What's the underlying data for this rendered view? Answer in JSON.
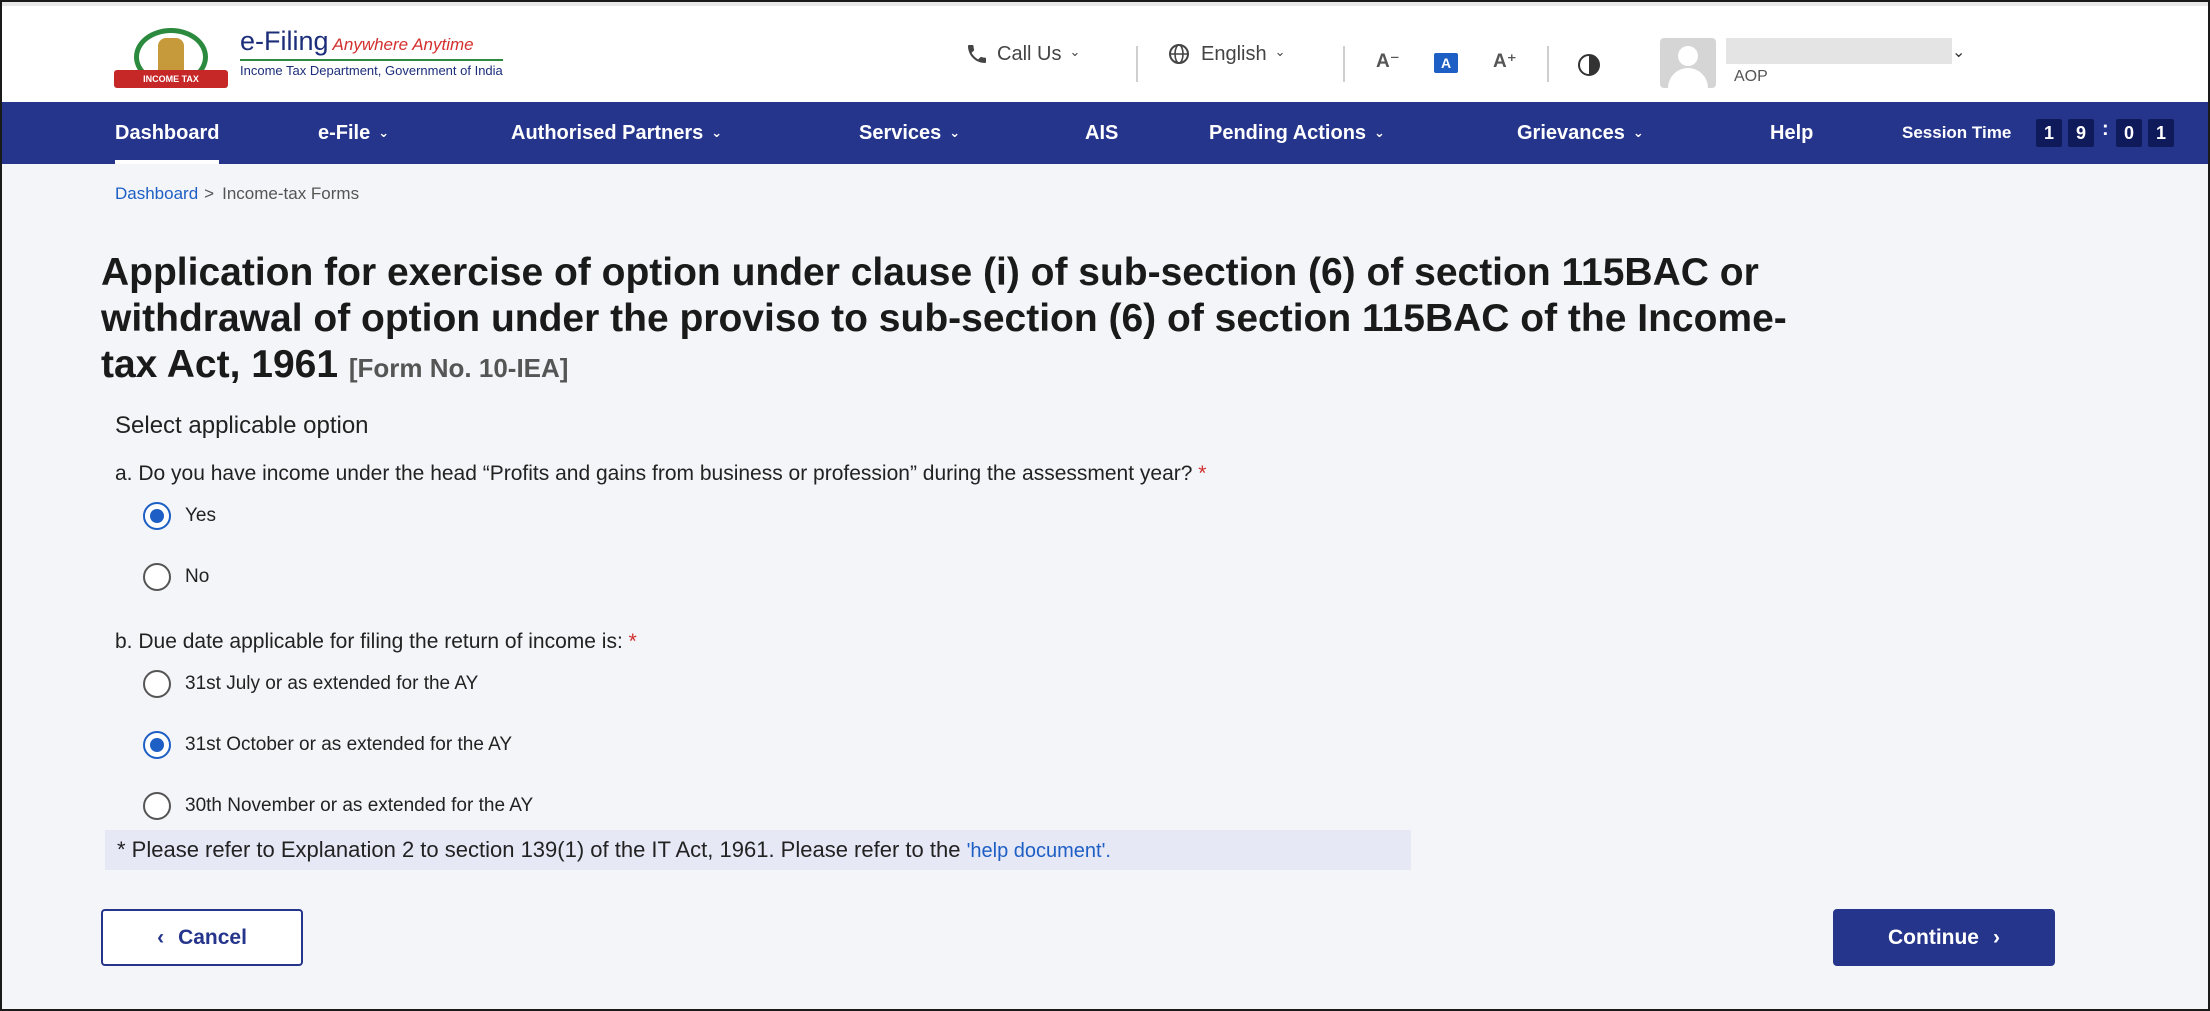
{
  "header": {
    "brand_name": "e-Filing",
    "brand_tagline": "Anywhere Anytime",
    "brand_dept": "Income Tax Department, Government of India",
    "emblem_ribbon": "INCOME TAX DEPARTMENT",
    "call_us": "Call Us",
    "language": "English",
    "font_decrease": "A⁻",
    "font_normal": "A",
    "font_increase": "A⁺",
    "user_role": "AOP",
    "icons": {
      "phone": "phone-icon",
      "globe": "globe-icon",
      "contrast": "contrast-icon",
      "avatar": "user-avatar-icon"
    }
  },
  "nav": {
    "items": [
      {
        "label": "Dashboard",
        "active": true
      },
      {
        "label": "e-File",
        "dropdown": true
      },
      {
        "label": "Authorised Partners",
        "dropdown": true
      },
      {
        "label": "Services",
        "dropdown": true
      },
      {
        "label": "AIS"
      },
      {
        "label": "Pending Actions",
        "dropdown": true
      },
      {
        "label": "Grievances",
        "dropdown": true
      },
      {
        "label": "Help"
      }
    ],
    "session_label": "Session Time",
    "session_digits": [
      "1",
      "9",
      "0",
      "1"
    ],
    "session_colon": ":"
  },
  "breadcrumb": {
    "home": "Dashboard",
    "separator": ">",
    "current": "Income-tax Forms"
  },
  "page": {
    "title": "Application for exercise of option under clause (i) of sub-section (6) of section 115BAC or withdrawal of option under the proviso to sub-section (6) of section 115BAC of the Income-tax Act, 1961",
    "form_no": "[Form No. 10-IEA]",
    "section_label": "Select applicable option"
  },
  "questions": {
    "a": {
      "text": "a. Do you have income under the head “Profits and gains from business or profession” during the assessment year?",
      "required": "*",
      "options": [
        "Yes",
        "No"
      ],
      "selected": "Yes"
    },
    "b": {
      "text": "b. Due date applicable for filing the return of income is:",
      "required": "*",
      "options": [
        "31st July or as extended for the AY",
        "31st October or as extended for the AY",
        "30th November or as extended for the AY"
      ],
      "selected": "31st October or as extended for the AY"
    }
  },
  "note": {
    "text": "* Please refer to Explanation 2 to section 139(1) of the IT Act, 1961. Please refer to the",
    "link": "'help document'."
  },
  "actions": {
    "cancel": "Cancel",
    "continue": "Continue"
  },
  "colors": {
    "primary": "#26358c",
    "link": "#1d5fc4",
    "required": "#d32f2f",
    "note_bg": "#e6e8f6"
  }
}
